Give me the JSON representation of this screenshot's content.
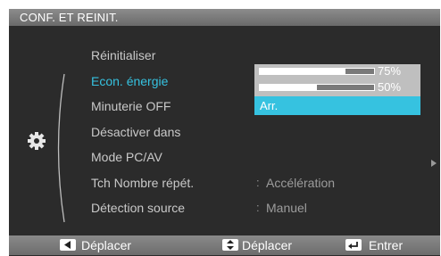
{
  "osd": {
    "title": "CONF. ET REINIT.",
    "menu": [
      {
        "label": "Réinitialiser",
        "value": "",
        "active": false
      },
      {
        "label": "Econ. énergie",
        "value": "",
        "active": true
      },
      {
        "label": "Minuterie OFF",
        "value": "",
        "active": false
      },
      {
        "label": "Désactiver dans",
        "value": "",
        "active": false
      },
      {
        "label": "Mode PC/AV",
        "value": "",
        "active": false
      },
      {
        "label": "Tch Nombre répét.",
        "value": "Accélération",
        "active": false
      },
      {
        "label": "Détection source",
        "value": "Manuel",
        "active": false
      }
    ],
    "separator": ":",
    "side_icon": "gear-icon",
    "submenu_indicator": "arrow-right-icon",
    "dropdown": {
      "options": [
        {
          "type": "bar",
          "level_percent": 75,
          "label": "75%"
        },
        {
          "type": "bar",
          "level_percent": 50,
          "label": "50%"
        },
        {
          "type": "text",
          "label": "Arr.",
          "selected": true
        }
      ]
    },
    "footer": [
      {
        "icon": "arrow-left-key-icon",
        "label": "Déplacer"
      },
      {
        "icon": "arrow-up-down-key-icon",
        "label": "Déplacer"
      },
      {
        "icon": "enter-key-icon",
        "label": "Entrer"
      }
    ]
  },
  "colors": {
    "accent": "#36c2e0",
    "background": "#2b2b2b",
    "inactive_text": "#c9c9c9",
    "dim_text": "#9c9c9c"
  }
}
